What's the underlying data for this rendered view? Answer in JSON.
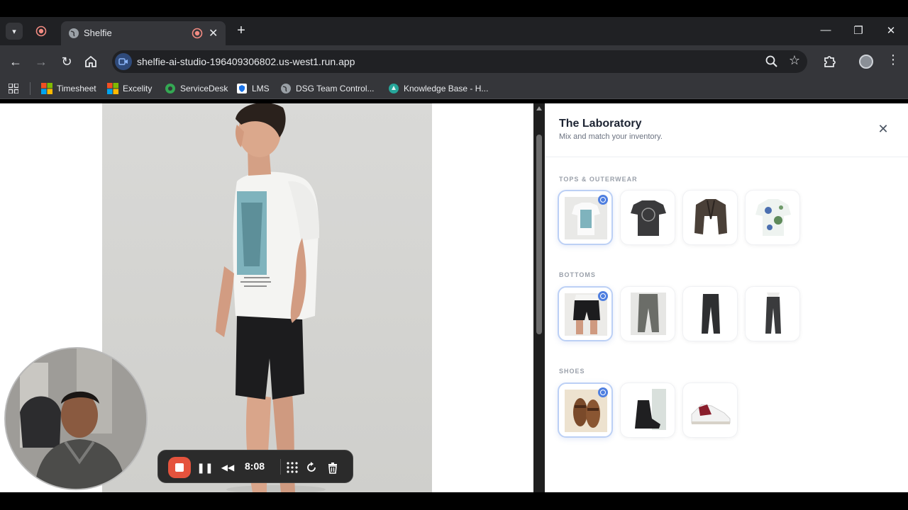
{
  "browser": {
    "tab_title": "Shelfie",
    "url": "shelfie-ai-studio-196409306802.us-west1.run.app",
    "new_tab_symbol": "+",
    "tab_close_symbol": "✕",
    "win_minimize": "—",
    "win_restore": "❐",
    "win_close": "✕",
    "bookmarks": [
      {
        "label": "Timesheet",
        "icon": "microsoft-icon"
      },
      {
        "label": "Excelity",
        "icon": "microsoft-icon"
      },
      {
        "label": "ServiceDesk",
        "icon": "servicedesk-icon"
      },
      {
        "label": "LMS",
        "icon": "shield-icon"
      },
      {
        "label": "DSG Team Control...",
        "icon": "globe-icon"
      },
      {
        "label": "Knowledge Base - H...",
        "icon": "knowledge-icon"
      }
    ]
  },
  "panel": {
    "title": "The Laboratory",
    "subtitle": "Mix and match your inventory.",
    "close_symbol": "✕",
    "sections": [
      {
        "label": "TOPS & OUTERWEAR",
        "items": [
          "graphic-tee",
          "dark-graphic-tee",
          "leather-jacket",
          "floral-shirt"
        ],
        "selected_index": 0
      },
      {
        "label": "BOTTOMS",
        "items": [
          "black-shorts",
          "grey-cargo-pants",
          "black-trousers",
          "black-chinos"
        ],
        "selected_index": 0
      },
      {
        "label": "SHOES",
        "items": [
          "brown-sandals",
          "black-boots",
          "red-sneakers"
        ],
        "selected_index": 0
      }
    ]
  },
  "recorder": {
    "time": "8:08",
    "pause_symbol": "❚❚",
    "rewind_symbol": "◀◀"
  },
  "colors": {
    "accent": "#4f7fe0",
    "record": "#e5533d",
    "chrome_dark": "#202124",
    "chrome_mid": "#35363a"
  }
}
